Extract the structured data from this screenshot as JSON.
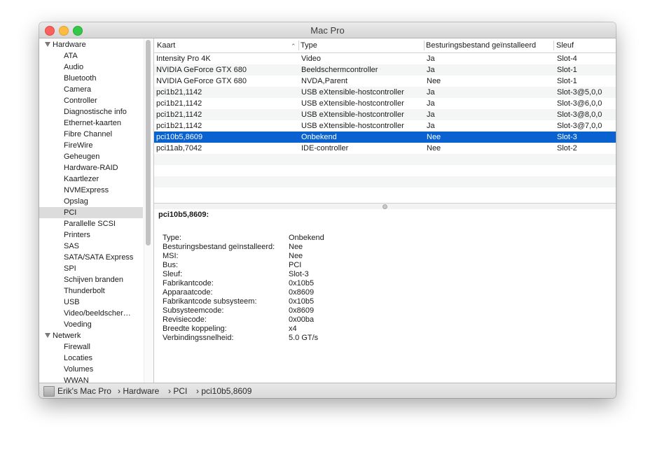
{
  "window": {
    "title": "Mac Pro"
  },
  "sidebar": {
    "items": [
      {
        "label": "Hardware",
        "group": true
      },
      {
        "label": "ATA"
      },
      {
        "label": "Audio"
      },
      {
        "label": "Bluetooth"
      },
      {
        "label": "Camera"
      },
      {
        "label": "Controller"
      },
      {
        "label": "Diagnostische info"
      },
      {
        "label": "Ethernet-kaarten"
      },
      {
        "label": "Fibre Channel"
      },
      {
        "label": "FireWire"
      },
      {
        "label": "Geheugen"
      },
      {
        "label": "Hardware-RAID"
      },
      {
        "label": "Kaartlezer"
      },
      {
        "label": "NVMExpress"
      },
      {
        "label": "Opslag"
      },
      {
        "label": "PCI",
        "selected": true
      },
      {
        "label": "Parallelle SCSI"
      },
      {
        "label": "Printers"
      },
      {
        "label": "SAS"
      },
      {
        "label": "SATA/SATA Express"
      },
      {
        "label": "SPI"
      },
      {
        "label": "Schijven branden"
      },
      {
        "label": "Thunderbolt"
      },
      {
        "label": "USB"
      },
      {
        "label": "Video/beeldscher…"
      },
      {
        "label": "Voeding"
      },
      {
        "label": "Netwerk",
        "group": true
      },
      {
        "label": "Firewall"
      },
      {
        "label": "Locaties"
      },
      {
        "label": "Volumes"
      },
      {
        "label": "WWAN"
      }
    ]
  },
  "table": {
    "columns": [
      "Kaart",
      "Type",
      "Besturingsbestand geïnstalleerd",
      "Sleuf"
    ],
    "sorted_column": "Kaart",
    "rows": [
      [
        "Intensity Pro 4K",
        "Video",
        "Ja",
        "Slot-4"
      ],
      [
        "NVIDIA GeForce GTX 680",
        "Beeldschermcontroller",
        "Ja",
        "Slot-1"
      ],
      [
        "NVIDIA GeForce GTX 680",
        "NVDA,Parent",
        "Nee",
        "Slot-1"
      ],
      [
        "pci1b21,1142",
        "USB eXtensible-hostcontroller",
        "Ja",
        "Slot-3@5,0,0"
      ],
      [
        "pci1b21,1142",
        "USB eXtensible-hostcontroller",
        "Ja",
        "Slot-3@6,0,0"
      ],
      [
        "pci1b21,1142",
        "USB eXtensible-hostcontroller",
        "Ja",
        "Slot-3@8,0,0"
      ],
      [
        "pci1b21,1142",
        "USB eXtensible-hostcontroller",
        "Ja",
        "Slot-3@7,0,0"
      ],
      [
        "pci10b5,8609",
        "Onbekend",
        "Nee",
        "Slot-3"
      ],
      [
        "pci11ab,7042",
        "IDE-controller",
        "Nee",
        "Slot-2"
      ]
    ],
    "selected_row": 7
  },
  "detail": {
    "title": "pci10b5,8609:",
    "fields": [
      {
        "label": "Type:",
        "value": "Onbekend"
      },
      {
        "label": "Besturingsbestand geïnstalleerd:",
        "value": "Nee"
      },
      {
        "label": "MSI:",
        "value": "Nee"
      },
      {
        "label": "Bus:",
        "value": "PCI"
      },
      {
        "label": "Sleuf:",
        "value": "Slot-3"
      },
      {
        "label": "Fabrikantcode:",
        "value": "0x10b5"
      },
      {
        "label": "Apparaatcode:",
        "value": "0x8609"
      },
      {
        "label": "Fabrikantcode subsysteem:",
        "value": "0x10b5"
      },
      {
        "label": "Subsysteemcode:",
        "value": "0x8609"
      },
      {
        "label": "Revisiecode:",
        "value": "0x00ba"
      },
      {
        "label": "Breedte koppeling:",
        "value": "x4"
      },
      {
        "label": "Verbindingssnelheid:",
        "value": "5.0 GT/s"
      }
    ]
  },
  "pathbar": {
    "segments": [
      "Erik's Mac Pro",
      "› Hardware",
      "› PCI",
      "› pci10b5,8609"
    ]
  },
  "colors": {
    "selection": "#0a62d0",
    "sidebar_selection": "#dcdcdc"
  }
}
